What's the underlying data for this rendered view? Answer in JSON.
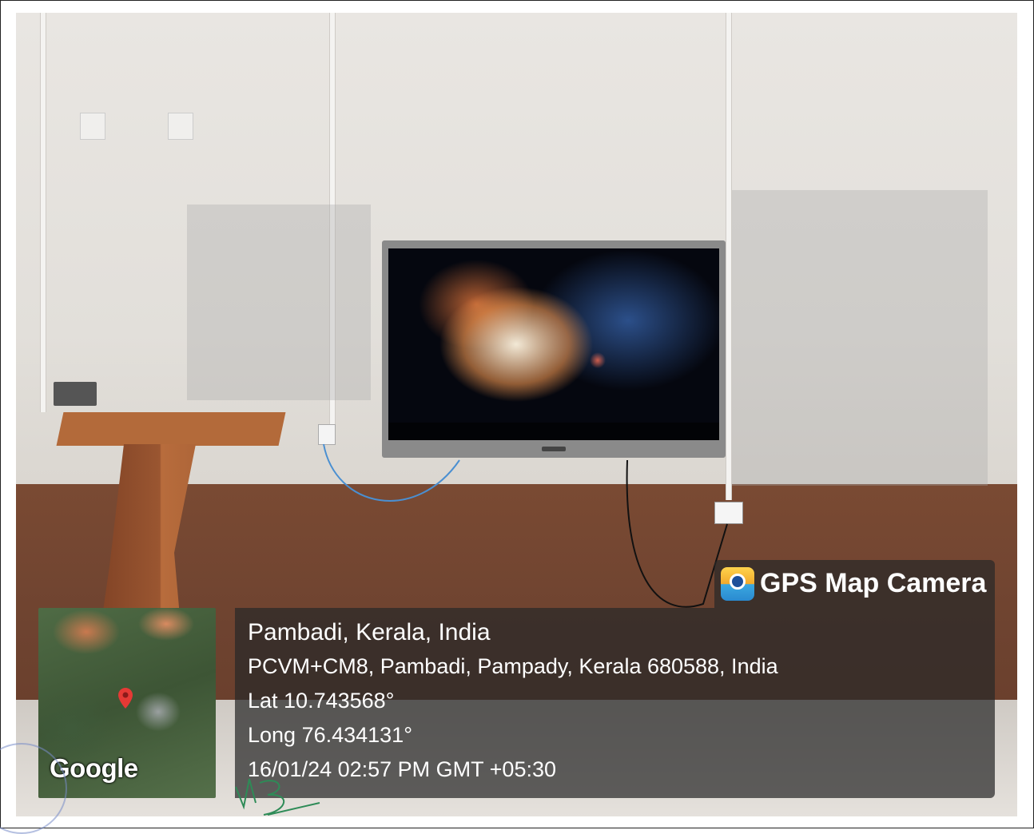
{
  "watermark": {
    "brand": "GPS Map Camera",
    "icon": "gps-map-camera-icon"
  },
  "location": {
    "place": "Pambadi, Kerala, India",
    "address": "PCVM+CM8, Pambadi, Pampady, Kerala 680588, India",
    "latitude": "Lat 10.743568°",
    "longitude": "Long 76.434131°",
    "timestamp": "16/01/24 02:57 PM GMT +05:30"
  },
  "map": {
    "provider_logo": "Google",
    "pin_icon": "map-pin-icon"
  },
  "colors": {
    "overlay": "#282828",
    "wall_lower": "#6e4330",
    "pin": "#e53935"
  }
}
